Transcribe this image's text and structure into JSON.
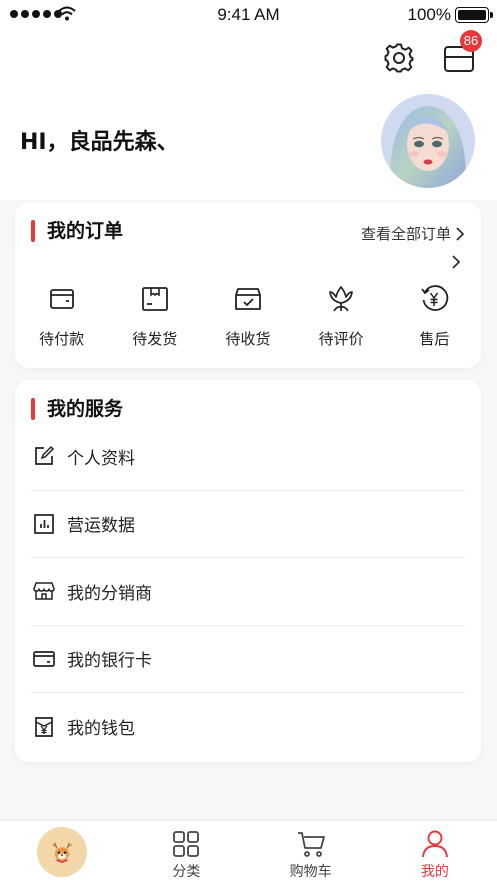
{
  "status_bar": {
    "time": "9:41 AM",
    "battery": "100%"
  },
  "header": {
    "greeting": "HI，良品先森、",
    "message_badge": "86"
  },
  "orders": {
    "title": "我的订单",
    "view_all": "查看全部订单",
    "items": [
      {
        "label": "待付款",
        "icon": "wallet-icon"
      },
      {
        "label": "待发货",
        "icon": "box-icon"
      },
      {
        "label": "待收货",
        "icon": "delivery-box-icon"
      },
      {
        "label": "待评价",
        "icon": "flower-icon"
      },
      {
        "label": "售后",
        "icon": "refund-icon"
      }
    ]
  },
  "services": {
    "title": "我的服务",
    "items": [
      {
        "label": "个人资料",
        "icon": "edit-icon"
      },
      {
        "label": "营运数据",
        "icon": "chart-icon"
      },
      {
        "label": "我的分销商",
        "icon": "store-icon"
      },
      {
        "label": "我的银行卡",
        "icon": "card-icon"
      },
      {
        "label": "我的钱包",
        "icon": "wallet-yen-icon"
      }
    ]
  },
  "tabbar": {
    "items": [
      {
        "label": "",
        "icon": "mascot-icon"
      },
      {
        "label": "分类",
        "icon": "grid-icon"
      },
      {
        "label": "购物车",
        "icon": "cart-icon"
      },
      {
        "label": "我的",
        "icon": "user-icon",
        "active": true
      }
    ]
  },
  "colors": {
    "accent": "#e8363b",
    "background": "#f7f7f7"
  }
}
